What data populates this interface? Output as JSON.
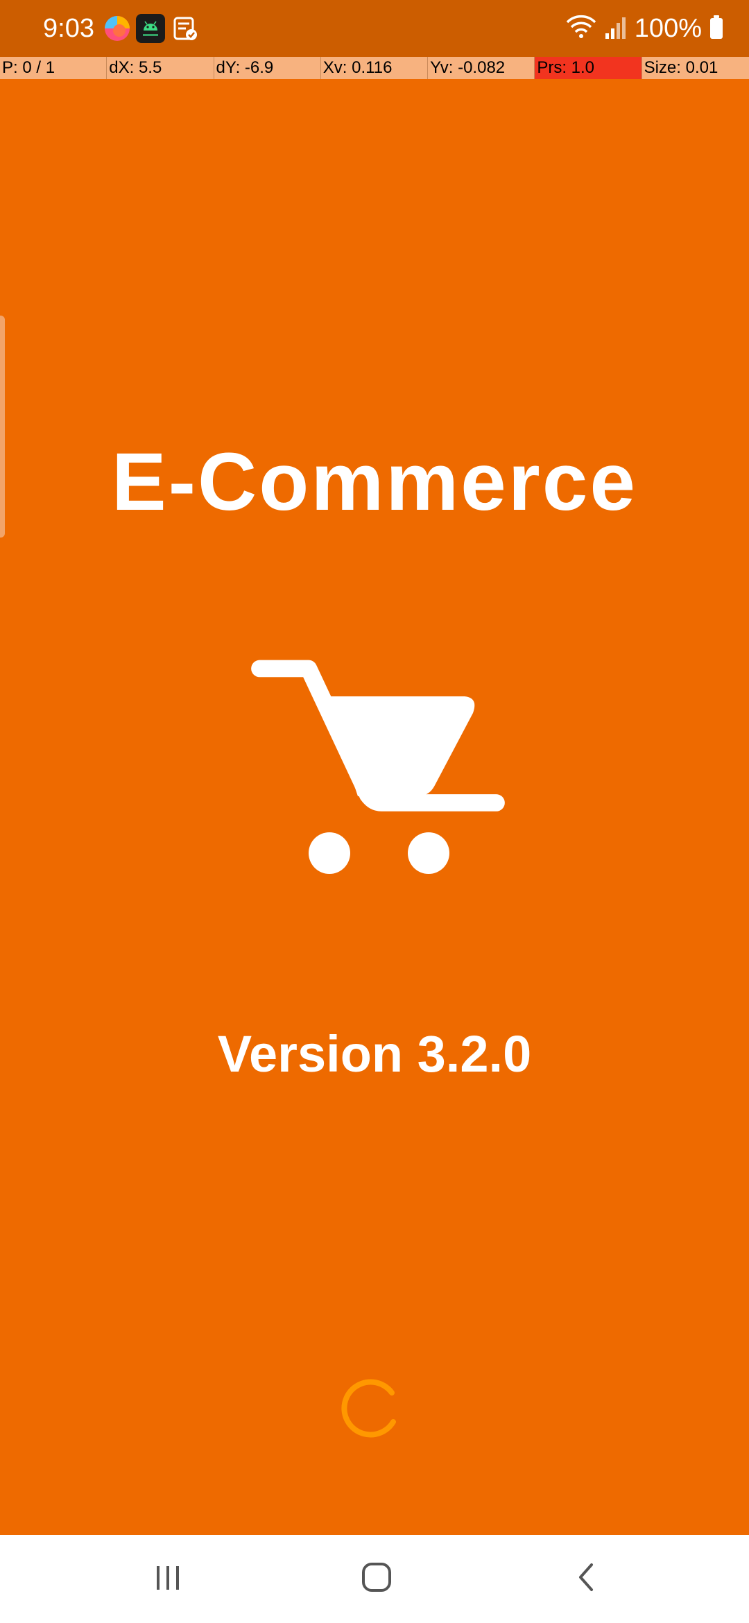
{
  "status_bar": {
    "time": "9:03",
    "battery_percent": "100%",
    "notification_icons": [
      "browser-icon",
      "android-app-icon",
      "note-check-icon"
    ],
    "system_icons": [
      "wifi-icon",
      "signal-icon",
      "battery-icon"
    ]
  },
  "pointer_overlay": {
    "pointer": "P: 0 / 1",
    "dx": "dX: 5.5",
    "dy": "dY: -6.9",
    "xv": "Xv: 0.116",
    "yv": "Yv: -0.082",
    "prs": "Prs: 1.0",
    "size": "Size: 0.01",
    "prs_highlight_color": "#f2341f"
  },
  "splash": {
    "title": "E-Commerce",
    "icon": "shopping-cart-icon",
    "version": "Version 3.2.0",
    "background_color": "#ee6a00",
    "spinner_color": "#ff9800"
  },
  "navigation_bar": {
    "buttons": [
      "recents-icon",
      "home-icon",
      "back-icon"
    ]
  }
}
